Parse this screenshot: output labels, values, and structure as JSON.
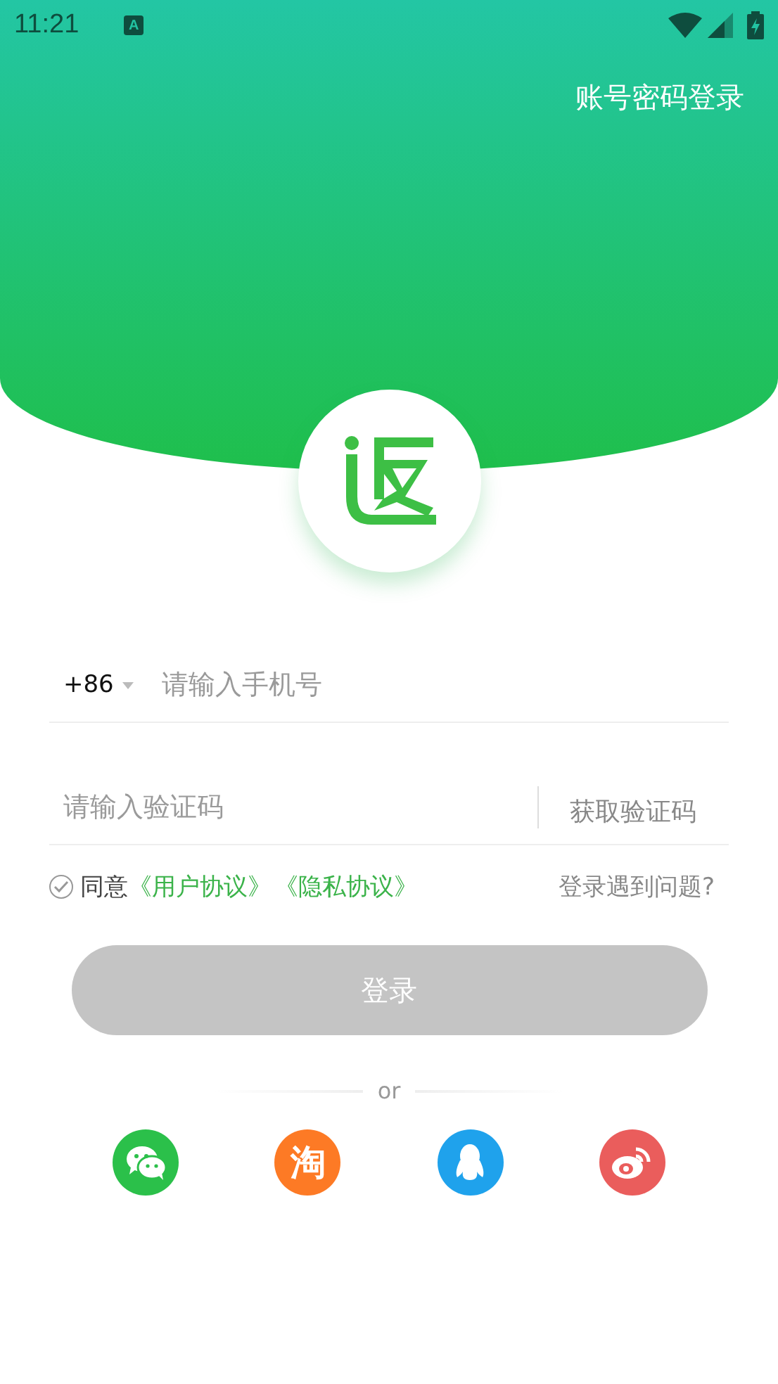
{
  "status_bar": {
    "time": "11:21",
    "input_badge": "A"
  },
  "header": {
    "account_login": "账号密码登录"
  },
  "phone": {
    "country_code": "+86",
    "placeholder": "请输入手机号"
  },
  "code": {
    "placeholder": "请输入验证码",
    "get_code": "获取验证码"
  },
  "agreement": {
    "checked": true,
    "prefix": "同意",
    "links": [
      "《用户协议》",
      "《隐私协议》"
    ],
    "help": "登录遇到问题?"
  },
  "login_button": {
    "label": "登录",
    "disabled": true
  },
  "divider": "or",
  "social": [
    {
      "kind": "wechat",
      "color": "#2bc04a"
    },
    {
      "kind": "taobao",
      "label": "淘",
      "color": "#fd7a25"
    },
    {
      "kind": "qq",
      "color": "#1fa2ec"
    },
    {
      "kind": "weibo",
      "color": "#ea5d5c"
    }
  ]
}
